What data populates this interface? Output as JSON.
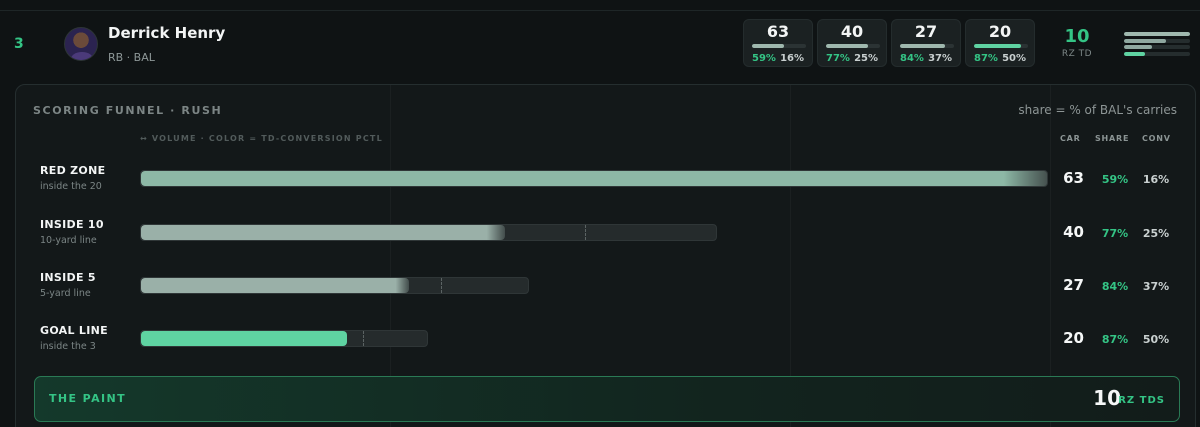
{
  "player": {
    "rank": "3",
    "name": "Derrick Henry",
    "meta": "RB · BAL"
  },
  "summary": [
    {
      "value": "63",
      "share": "59%",
      "conv": "16%",
      "level": 0.59,
      "color": "#9fb8ae"
    },
    {
      "value": "40",
      "share": "77%",
      "conv": "25%",
      "level": 0.77,
      "color": "#9fb8ae"
    },
    {
      "value": "27",
      "share": "84%",
      "conv": "37%",
      "level": 0.84,
      "color": "#9fb8ae"
    },
    {
      "value": "20",
      "share": "87%",
      "conv": "50%",
      "level": 0.87,
      "color": "#5fd3a2"
    }
  ],
  "rz_td": {
    "value": "10",
    "label": "RZ TD"
  },
  "mini_bars": [
    {
      "level": 1.0,
      "color": "#9fb8ae"
    },
    {
      "level": 0.63,
      "color": "#8fa8a0"
    },
    {
      "level": 0.43,
      "color": "#8fa8a0"
    },
    {
      "level": 0.32,
      "color": "#5fd3a2"
    }
  ],
  "funnel": {
    "title": "SCORING FUNNEL · RUSH",
    "note": "share = % of BAL's carries",
    "legend": "↔ VOLUME · COLOR = TD-CONVERSION PCTL",
    "col_car": "CAR",
    "col_share": "SHARE",
    "col_conv": "CONV",
    "rows": [
      {
        "label": "RED ZONE",
        "sub": "inside the 20",
        "car": "63",
        "share": "59%",
        "conv": "16%",
        "carries": 63,
        "share_frac": 0.59,
        "color": "#8db8a6"
      },
      {
        "label": "INSIDE 10",
        "sub": "10-yard line",
        "car": "40",
        "share": "77%",
        "conv": "25%",
        "carries": 40,
        "share_frac": 0.77,
        "color": "#9ab0a8"
      },
      {
        "label": "INSIDE 5",
        "sub": "5-yard line",
        "car": "27",
        "share": "84%",
        "conv": "37%",
        "carries": 27,
        "share_frac": 0.84,
        "color": "#9ab0a8"
      },
      {
        "label": "GOAL LINE",
        "sub": "inside the 3",
        "car": "20",
        "share": "87%",
        "conv": "50%",
        "carries": 20,
        "share_frac": 0.87,
        "color": "#5fd3a2"
      }
    ]
  },
  "paint": {
    "label": "THE PAINT",
    "value": "10",
    "unit": "RZ TDS"
  }
}
